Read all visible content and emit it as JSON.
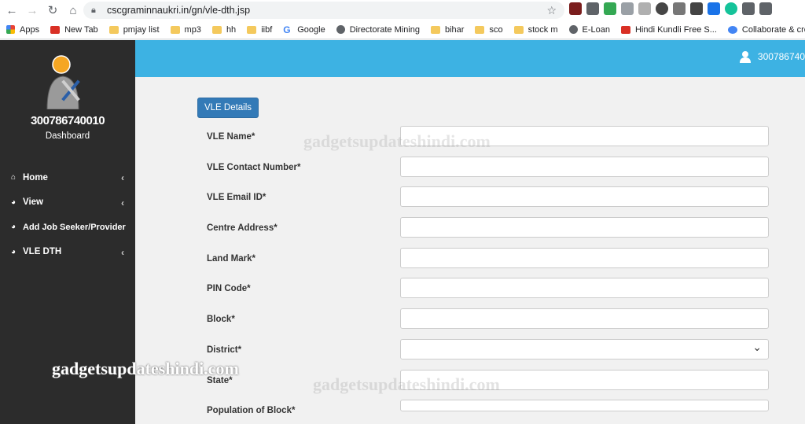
{
  "browser": {
    "url": "cscgraminnaukri.in/gn/vle-dth.jsp",
    "bookmarks": [
      "Apps",
      "New Tab",
      "pmjay list",
      "mp3",
      "hh",
      "iibf",
      "Google",
      "Directorate Mining",
      "bihar",
      "sco",
      "stock m",
      "E-Loan",
      "Hindi Kundli Free S...",
      "Collaborate & creat..."
    ]
  },
  "sidebar": {
    "user_id": "300786740010",
    "dashboard_label": "Dashboard",
    "items": [
      {
        "label": "Home"
      },
      {
        "label": "View"
      },
      {
        "label": "Add Job Seeker/Provider"
      },
      {
        "label": "VLE DTH"
      }
    ]
  },
  "header": {
    "user_id": "300786740"
  },
  "form": {
    "section_label": "VLE Details",
    "fields": [
      {
        "label": "VLE Name*",
        "value": ""
      },
      {
        "label": "VLE Contact Number*",
        "value": ""
      },
      {
        "label": "VLE Email ID*",
        "value": ""
      },
      {
        "label": "Centre Address*",
        "value": ""
      },
      {
        "label": "Land Mark*",
        "value": ""
      },
      {
        "label": "PIN Code*",
        "value": ""
      },
      {
        "label": "Block*",
        "value": ""
      },
      {
        "label": "District*",
        "value": ""
      },
      {
        "label": "State*",
        "value": ""
      },
      {
        "label": "Population of Block*",
        "value": ""
      }
    ]
  },
  "watermark": "gadgetsupdateshindi.com",
  "colors": {
    "header": "#3db2e3",
    "sidebar": "#2c2c2c",
    "button": "#337ab7"
  }
}
